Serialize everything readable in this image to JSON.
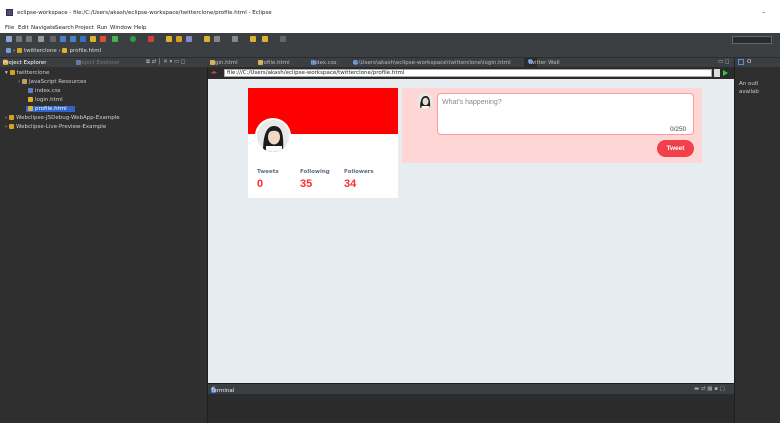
{
  "window": {
    "title": "eclipse-workspace - file:/C:/Users/akash/eclipse-workspace/twitterclone/profile.html - Eclipse",
    "minimize": "–"
  },
  "menu": [
    "File",
    "Edit",
    "Navigate",
    "Search",
    "Project",
    "Run",
    "Window",
    "Help"
  ],
  "breadcrumb": {
    "project": "twitterclone",
    "file": "profile.html"
  },
  "project_explorer": {
    "tabs": [
      "Project Explorer",
      "Project Explorer"
    ],
    "tree": [
      {
        "label": "twitterclone",
        "level": 0,
        "icon": "project-icon"
      },
      {
        "label": "JavaScript Resources",
        "level": 1,
        "icon": "js-resources-icon"
      },
      {
        "label": "index.css",
        "level": 2,
        "icon": "css-file-icon"
      },
      {
        "label": "login.html",
        "level": 2,
        "icon": "html-file-icon"
      },
      {
        "label": "profile.html",
        "level": 2,
        "icon": "html-file-icon",
        "selected": true
      },
      {
        "label": "Webclipse-JSDebug-WebApp-Example",
        "level": 0,
        "icon": "project-icon"
      },
      {
        "label": "Webclipse-Live-Preview-Example",
        "level": 0,
        "icon": "project-icon"
      }
    ]
  },
  "editor_tabs": [
    {
      "label": "login.html",
      "active": false
    },
    {
      "label": "profile.html",
      "active": false
    },
    {
      "label": "index.css",
      "active": false
    },
    {
      "label": "C:\\Users\\akash\\eclipse-workspace\\twitterclone\\login.html",
      "active": false
    },
    {
      "label": "Twitter Wall",
      "active": true
    }
  ],
  "browser": {
    "url": "file:///C:/Users/akash/eclipse-workspace/twitterclone/profile.html"
  },
  "profile": {
    "stats": [
      {
        "label": "Tweets",
        "value": "0"
      },
      {
        "label": "Following",
        "value": "35"
      },
      {
        "label": "Followers",
        "value": "34"
      }
    ]
  },
  "compose": {
    "placeholder": "What's happening?",
    "counter": "0/250",
    "button": "Tweet"
  },
  "outline": {
    "title": "O",
    "message_line1": "An outl",
    "message_line2": "availab"
  },
  "terminal": {
    "tab": "Terminal"
  },
  "colors": {
    "cover": "#ff0000",
    "accent": "#f0404a",
    "stat_value": "#ff2b2b",
    "compose_bg": "#ffd6d6"
  }
}
